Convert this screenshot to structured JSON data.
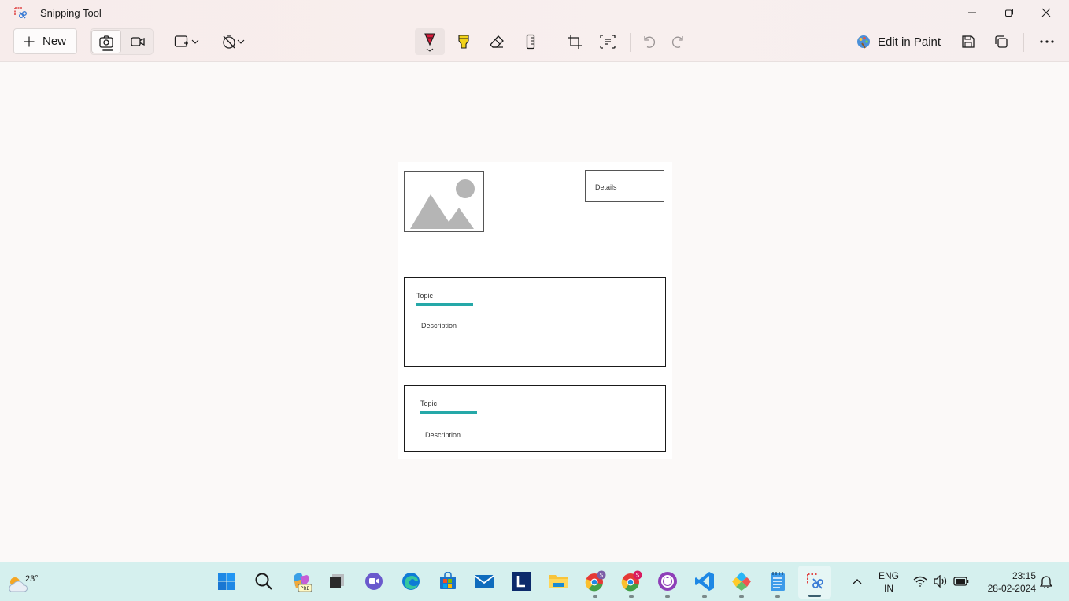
{
  "app": {
    "title": "Snipping Tool"
  },
  "toolbar": {
    "new_label": "New",
    "edit_in_paint_label": "Edit in Paint"
  },
  "canvas": {
    "details_label": "Details",
    "cards": [
      {
        "topic": "Topic",
        "description": "Description"
      },
      {
        "topic": "Topic",
        "description": "Description"
      }
    ],
    "accent_color": "#25a8a8"
  },
  "taskbar": {
    "weather_temp": "23°",
    "lang_primary": "ENG",
    "lang_secondary": "IN",
    "time": "23:15",
    "date": "28-02-2024",
    "badges": {
      "copilot": "PRE",
      "chrome1": "S",
      "chrome2": "S"
    }
  }
}
